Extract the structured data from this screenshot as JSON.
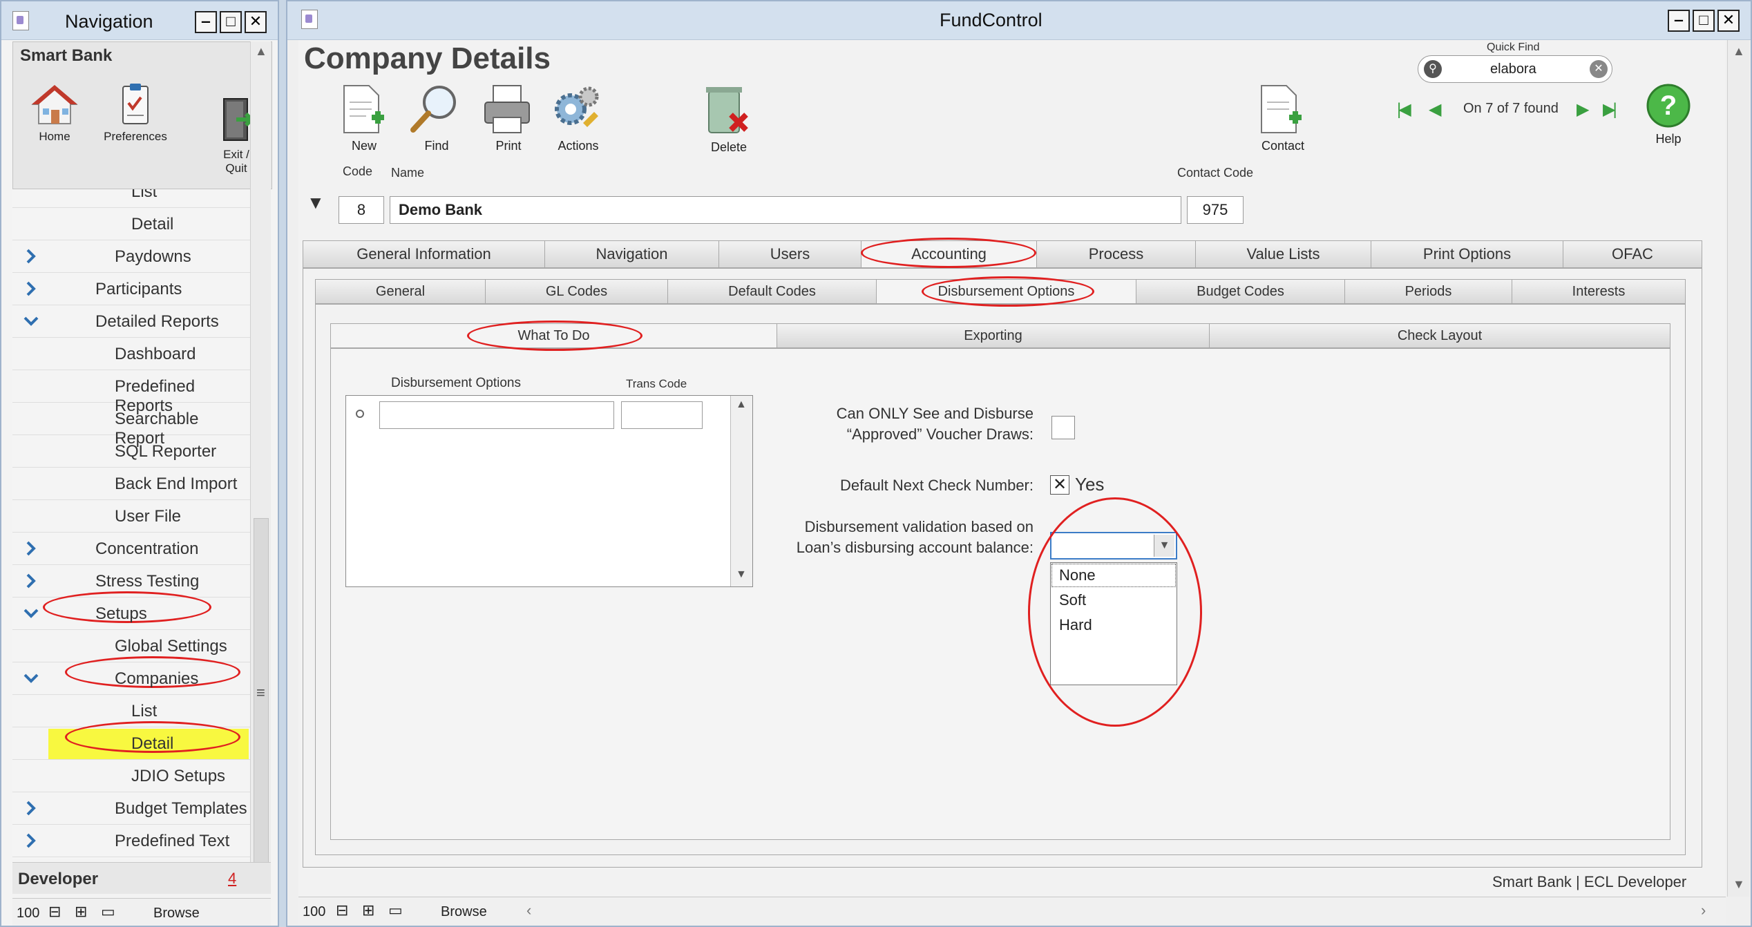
{
  "nav": {
    "title": "Navigation",
    "section_title": "Smart Bank",
    "toolbar": [
      {
        "label": "Home",
        "icon": "home-icon"
      },
      {
        "label": "Preferences",
        "icon": "clipboard-icon"
      },
      {
        "label": "Exit /\nQuit",
        "icon": "exit-door-icon"
      }
    ],
    "items": [
      {
        "label": "List",
        "indent": 2,
        "chevron": ""
      },
      {
        "label": "Detail",
        "indent": 2,
        "chevron": ""
      },
      {
        "label": "Paydowns",
        "indent": 1,
        "chevron": "right"
      },
      {
        "label": "Participants",
        "indent": 0,
        "chevron": "right"
      },
      {
        "label": "Detailed Reports",
        "indent": 0,
        "chevron": "down"
      },
      {
        "label": "Dashboard",
        "indent": 1,
        "chevron": ""
      },
      {
        "label": "Predefined Reports",
        "indent": 1,
        "chevron": ""
      },
      {
        "label": "Searchable Report",
        "indent": 1,
        "chevron": ""
      },
      {
        "label": "SQL Reporter",
        "indent": 1,
        "chevron": ""
      },
      {
        "label": "Back End Import",
        "indent": 1,
        "chevron": ""
      },
      {
        "label": "User File",
        "indent": 1,
        "chevron": ""
      },
      {
        "label": "Concentration",
        "indent": 0,
        "chevron": "right"
      },
      {
        "label": "Stress Testing",
        "indent": 0,
        "chevron": "right"
      },
      {
        "label": "Setups",
        "indent": 0,
        "chevron": "down"
      },
      {
        "label": "Global Settings",
        "indent": 1,
        "chevron": ""
      },
      {
        "label": "Companies",
        "indent": 1,
        "chevron": "down"
      },
      {
        "label": "List",
        "indent": 2,
        "chevron": ""
      },
      {
        "label": "Detail",
        "indent": 2,
        "chevron": "",
        "highlight": true
      },
      {
        "label": "JDIO Setups",
        "indent": 2,
        "chevron": ""
      },
      {
        "label": "Budget Templates",
        "indent": 1,
        "chevron": "right"
      },
      {
        "label": "Predefined Text",
        "indent": 1,
        "chevron": "right"
      }
    ],
    "developer_label": "Developer",
    "developer_count": "4",
    "status": {
      "zoom": "100",
      "mode": "Browse"
    }
  },
  "main": {
    "window_title": "FundControl",
    "page_title": "Company Details",
    "toolbar": {
      "new": "New",
      "find": "Find",
      "print": "Print",
      "actions": "Actions",
      "delete": "Delete",
      "contact": "Contact",
      "help": "Help"
    },
    "quick_find": {
      "label": "Quick Find",
      "value": "elabora"
    },
    "record_nav": "On 7 of 7 found",
    "fields": {
      "code_label": "Code",
      "name_label": "Name",
      "contact_code_label": "Contact Code",
      "code": "8",
      "name": "Demo Bank",
      "contact_code": "975"
    },
    "tabs": [
      "General Information",
      "Navigation",
      "Users",
      "Accounting",
      "Process",
      "Value Lists",
      "Print Options",
      "OFAC"
    ],
    "subtabs": [
      "General",
      "GL Codes",
      "Default Codes",
      "Disbursement Options",
      "Budget Codes",
      "Periods",
      "Interests"
    ],
    "subsubtabs": [
      "What To Do",
      "Exporting",
      "Check Layout"
    ],
    "disb": {
      "col_options": "Disbursement Options",
      "col_trans": "Trans Code",
      "can_only_label": "Can ONLY See and Disburse\n“Approved” Voucher Draws:",
      "default_next_label": "Default Next Check Number:",
      "default_next_value": "Yes",
      "validation_label": "Disbursement validation based on\nLoan’s disbursing account balance:",
      "dropdown_options": [
        "None",
        "Soft",
        "Hard"
      ]
    },
    "status_line": "Smart Bank | ECL Developer",
    "status": {
      "zoom": "100",
      "mode": "Browse"
    }
  }
}
